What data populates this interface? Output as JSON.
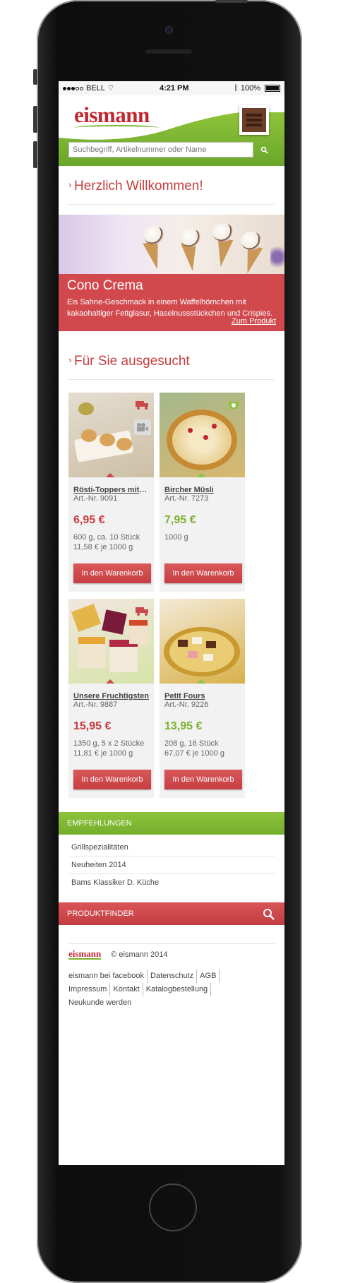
{
  "status": {
    "carrier": "BELL",
    "time": "4:21 PM",
    "battery": "100%"
  },
  "header": {
    "logo": "eismann",
    "search_placeholder": "Suchbegriff, Artikelnummer oder Name"
  },
  "welcome": {
    "title": "Herzlich Willkommen!"
  },
  "banner": {
    "title": "Cono Crema",
    "text": "Eis Sahne-Geschmack in einem Waffelhörnchen mit kakaohaltiger Fettglasur, Haselnussstückchen und Crispies.",
    "link": "Zum Produkt"
  },
  "selection": {
    "title": "Für Sie ausgesucht"
  },
  "products": [
    {
      "name": "Rösti-Toppers mit Ph...",
      "art": "Art.-Nr. 9091",
      "price": "6,95 €",
      "info1": "600 g, ca. 10 Stück",
      "info2": "11,58 € je 1000 g",
      "button": "In den Warenkorb",
      "accent": "#c73d3e"
    },
    {
      "name": "Bircher Müsli",
      "art": "Art.-Nr. 7273",
      "price": "7,95 €",
      "info1": "1000 g",
      "info2": "",
      "button": "In den Warenkorb",
      "accent": "#7cb230"
    },
    {
      "name": "Unsere Fruchtigsten",
      "art": "Art.-Nr. 9887",
      "price": "15,95 €",
      "info1": "1350 g, 5 x 2 Stücke",
      "info2": "11,81 € je 1000 g",
      "button": "In den Warenkorb",
      "accent": "#c73d3e"
    },
    {
      "name": "Petit Fours",
      "art": "Art.-Nr. 9226",
      "price": "13,95 €",
      "info1": "208 g, 16 Stück",
      "info2": "67,07 € je 1000 g",
      "button": "In den Warenkorb",
      "accent": "#7cb230"
    }
  ],
  "recommendations": {
    "title": "EMPFEHLUNGEN",
    "items": [
      "Grillspezialitäten",
      "Neuheiten 2014",
      "Bams Klassiker D. Küche"
    ]
  },
  "produktfinder": {
    "title": "PRODUKTFINDER"
  },
  "footer": {
    "logo": "eismann",
    "copyright": "© eismann 2014",
    "links": [
      "eismann bei facebook",
      "Datenschutz",
      "AGB",
      "Impressum",
      "Kontakt",
      "Katalogbestellung",
      "Neukunde werden"
    ]
  },
  "colors": {
    "brand_red": "#c73d3e",
    "brand_green": "#7cb230"
  }
}
